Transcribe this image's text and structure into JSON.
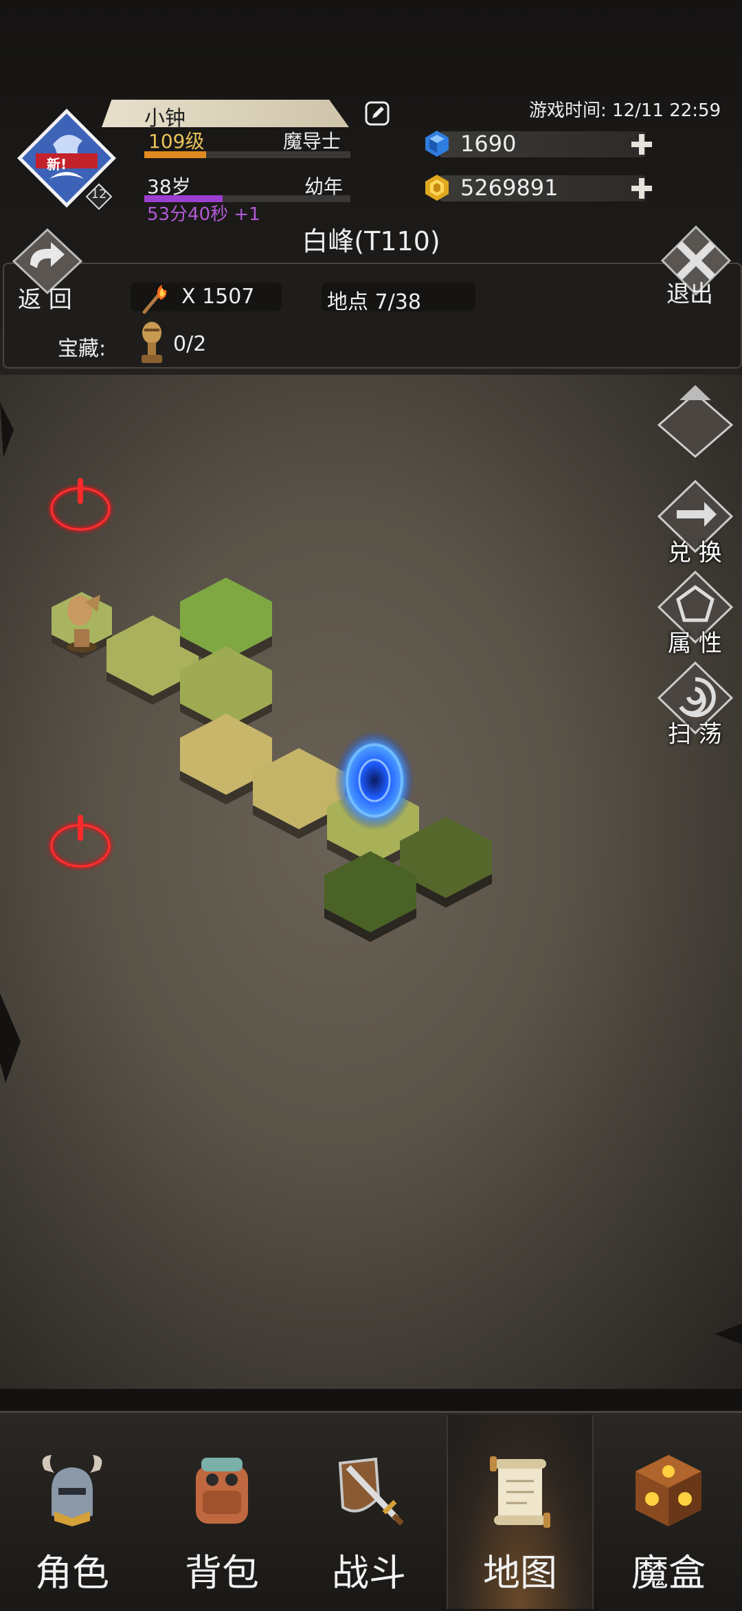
{
  "player": {
    "name": "小钟",
    "new_badge": "新!",
    "avatar_level": "12",
    "level": "109级",
    "class": "魔导士",
    "exp_progress": 0.3,
    "age": "38岁",
    "age_stage": "幼年",
    "age_progress": 0.38,
    "age_timer": "53分40秒 +1"
  },
  "game_time": "游戏时间: 12/11 22:59",
  "currency": {
    "gems": "1690",
    "gold": "5269891"
  },
  "map": {
    "title": "白峰(T110)",
    "back_label": "返 回",
    "exit_label": "退出",
    "torch_count": "X 1507",
    "location_label": "地点 7/38",
    "treasure_label": "宝藏:",
    "treasure_count": "0/2"
  },
  "side_buttons": {
    "exchange": "兑 换",
    "attributes": "属 性",
    "sweep": "扫 荡"
  },
  "nav": {
    "items": [
      {
        "label": "角色",
        "icon": "helmet-icon"
      },
      {
        "label": "背包",
        "icon": "backpack-icon"
      },
      {
        "label": "战斗",
        "icon": "sword-shield-icon"
      },
      {
        "label": "地图",
        "icon": "scroll-map-icon"
      },
      {
        "label": "魔盒",
        "icon": "magic-box-icon"
      }
    ],
    "active_index": 3
  },
  "colors": {
    "level_text": "#e8c35a",
    "exp_bar": "#e08a20",
    "age_bar": "#9b3fd0",
    "age_timer": "#b35ad8",
    "portal": "#2a7bff",
    "alert": "#e0181c"
  }
}
